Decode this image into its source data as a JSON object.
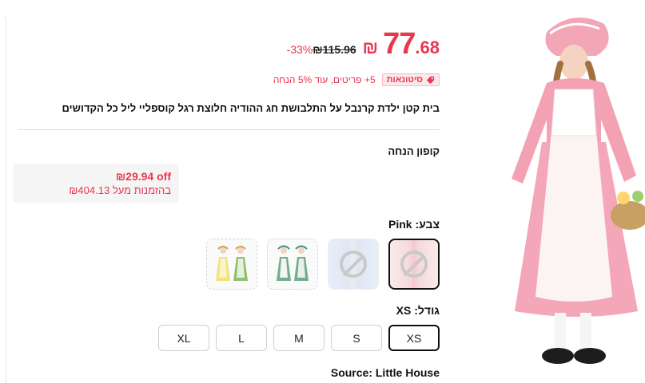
{
  "price": {
    "current_symbol": "₪",
    "current_int": "77",
    "current_dec": ".68",
    "original": "₪115.96",
    "discount": "-33%"
  },
  "promo": {
    "badge_label": "סיטונאות",
    "text": "5+ פריטים, עוד 5% הנחה"
  },
  "product": {
    "title": "בית קטן ילדת קרנבל על התלבושת חג ההודיה חלוצת רגל קוספליי ליל כל הקדושים"
  },
  "coupon": {
    "label": "קופון הנחה",
    "off": "₪29.94 off",
    "min": "בהזמנות מעל ₪404.13"
  },
  "color": {
    "label": "צבע: Pink",
    "options": [
      "Pink",
      "Blue",
      "Green",
      "Yellow"
    ]
  },
  "size": {
    "label": "גודל: XS",
    "options": [
      "XS",
      "S",
      "M",
      "L",
      "XL"
    ],
    "selected": "XS"
  },
  "source": {
    "text": "Source: Little House"
  },
  "colors": {
    "accent": "#e8384f",
    "text": "#111111",
    "badge_bg": "#fde8ea"
  },
  "icons": {
    "tag": "tag-icon",
    "unavailable": "ban-icon"
  }
}
